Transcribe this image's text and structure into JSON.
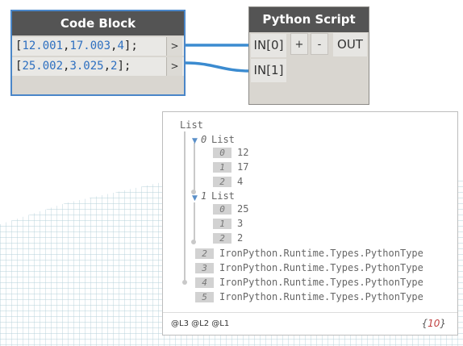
{
  "code_block": {
    "title": "Code Block",
    "lines": [
      {
        "values": [
          "12.001",
          "17.003",
          "4"
        ],
        "port": ">"
      },
      {
        "values": [
          "25.002",
          "3.025",
          "2"
        ],
        "port": ">"
      }
    ]
  },
  "python_script": {
    "title": "Python Script",
    "inputs": [
      "IN[0]",
      "IN[1]"
    ],
    "add_label": "+",
    "remove_label": "-",
    "output": "OUT"
  },
  "preview": {
    "root": "List",
    "groups": [
      {
        "index": "0",
        "label": "List",
        "items": [
          {
            "index": "0",
            "value": "12"
          },
          {
            "index": "1",
            "value": "17"
          },
          {
            "index": "2",
            "value": "4"
          }
        ]
      },
      {
        "index": "1",
        "label": "List",
        "items": [
          {
            "index": "0",
            "value": "25"
          },
          {
            "index": "1",
            "value": "3"
          },
          {
            "index": "2",
            "value": "2"
          }
        ]
      }
    ],
    "extra_items": [
      {
        "index": "2",
        "value": "IronPython.Runtime.Types.PythonType"
      },
      {
        "index": "3",
        "value": "IronPython.Runtime.Types.PythonType"
      },
      {
        "index": "4",
        "value": "IronPython.Runtime.Types.PythonType"
      },
      {
        "index": "5",
        "value": "IronPython.Runtime.Types.PythonType"
      }
    ],
    "levels": [
      "@L3",
      "@L2",
      "@L1"
    ],
    "count": "10"
  },
  "colors": {
    "node_header": "#545454",
    "node_body": "#d9d6d0",
    "selected_border": "#4a86c8",
    "wire": "#3b8bd0",
    "number_blue": "#2d6fc0",
    "grid_line": "#a9c8d4"
  }
}
